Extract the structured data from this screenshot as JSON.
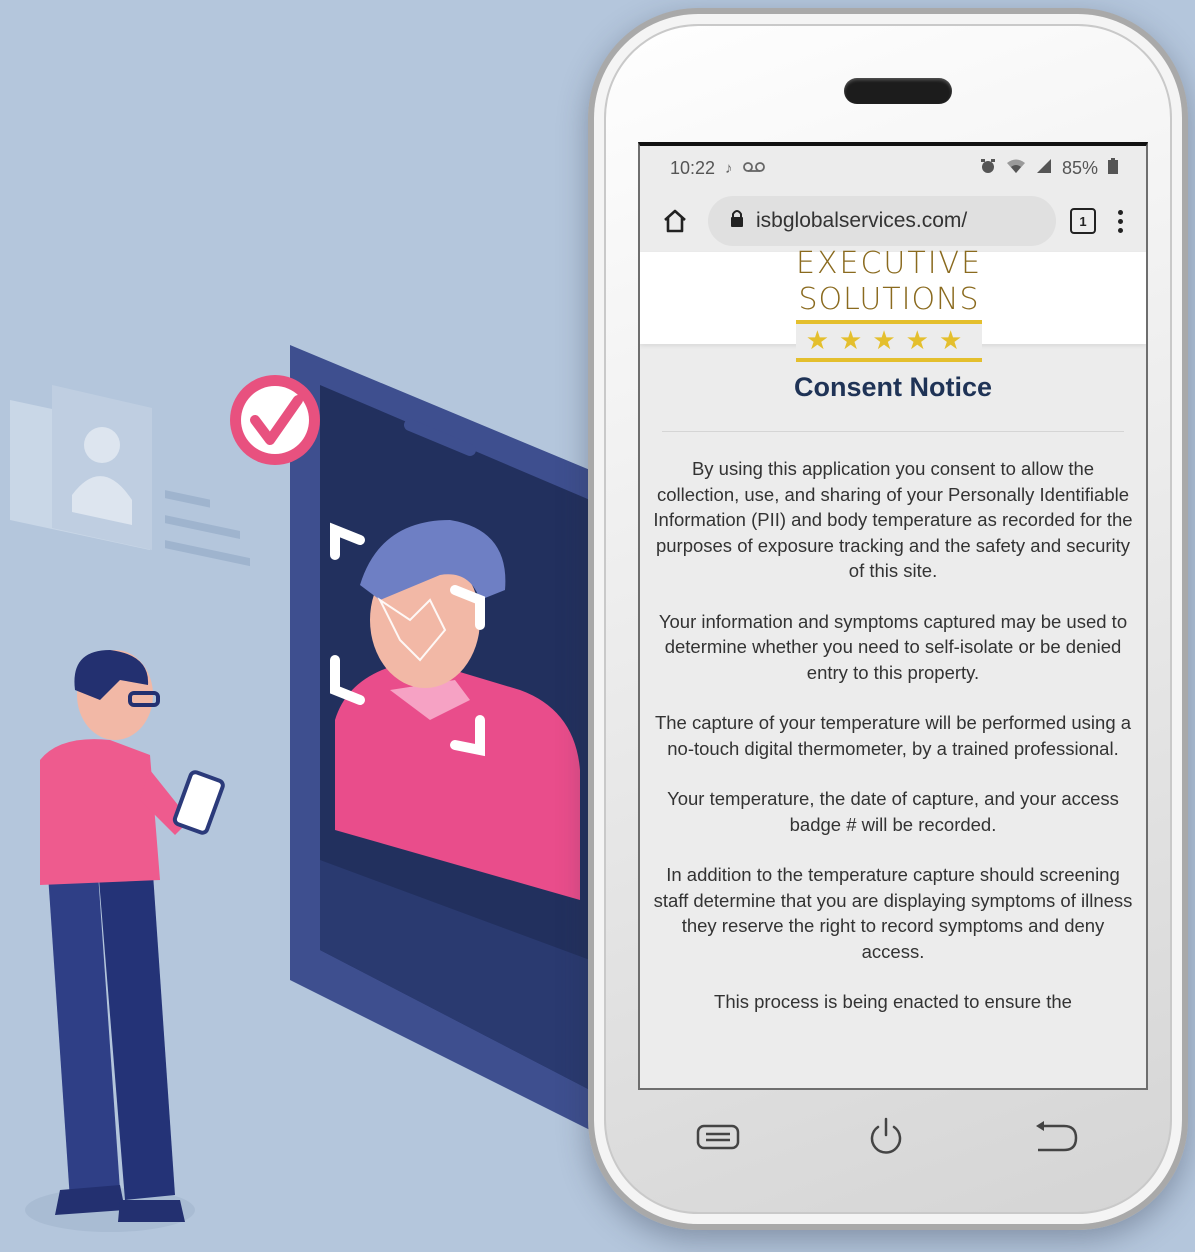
{
  "colors": {
    "background": "#b4c6dc",
    "title": "#1f3356",
    "logo_gold": "#e4bf2d",
    "accent_pink": "#ee5b8e"
  },
  "statusbar": {
    "time": "10:22",
    "left_icons": [
      "music-note-icon",
      "voicemail-icon"
    ],
    "right_icons": [
      "alarm-icon",
      "wifi-icon",
      "signal-icon"
    ],
    "battery": "85%"
  },
  "browser": {
    "url": "isbglobalservices.com/",
    "tab_count": "1"
  },
  "logo": {
    "line1": "EXECUTIVE",
    "line2": "SOLUTIONS",
    "stars": "★★★★★"
  },
  "consent": {
    "title": "Consent Notice",
    "paragraphs": [
      "By using this application you consent to allow the collection, use, and sharing of your Personally Identifiable Information (PII) and body temperature as recorded for the purposes of exposure tracking and the safety and security of this site.",
      "Your information and symptoms captured may be used to determine whether you need to self-isolate or be denied entry to this property.",
      "The capture of your temperature will be performed using a no-touch digital thermometer, by a trained professional.",
      "Your temperature, the date of capture, and your access badge # will be recorded.",
      "In addition to the temperature capture should screening staff determine that you are displaying symptoms of illness they reserve the right to record symptoms and deny access.",
      "This process is being enacted to ensure the"
    ]
  },
  "navbar": {
    "icons": [
      "recent-apps-icon",
      "power-icon",
      "back-icon"
    ]
  }
}
